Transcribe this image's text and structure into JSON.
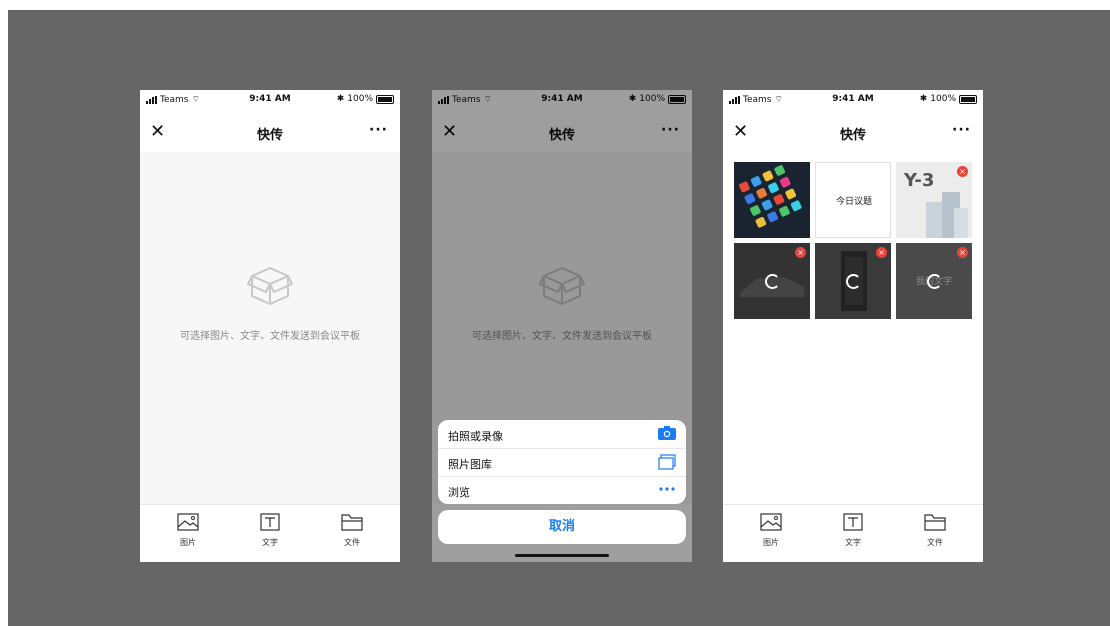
{
  "status": {
    "carrier": "Teams",
    "time": "9:41 AM",
    "battery": "100%"
  },
  "nav": {
    "close": "✕",
    "title": "快传",
    "more": "···"
  },
  "empty_hint": "可选择图片、文字、文件发送到会议平板",
  "tabs": [
    {
      "label": "图片",
      "icon": "image-icon"
    },
    {
      "label": "文字",
      "icon": "text-icon"
    },
    {
      "label": "文件",
      "icon": "folder-icon"
    }
  ],
  "sheet": {
    "items": [
      {
        "label": "拍照或录像",
        "icon": "camera-icon"
      },
      {
        "label": "照片图库",
        "icon": "photo-library-icon"
      },
      {
        "label": "浏览",
        "icon": "more-dots-icon"
      }
    ],
    "cancel": "取消"
  },
  "grid": {
    "text_tile": "今日议题",
    "y3_logo": "Y-3",
    "loading_caption": "我的文字"
  },
  "colors": {
    "accent": "#1a7cf0",
    "remove": "#e8443a",
    "backdrop": "#666666"
  }
}
